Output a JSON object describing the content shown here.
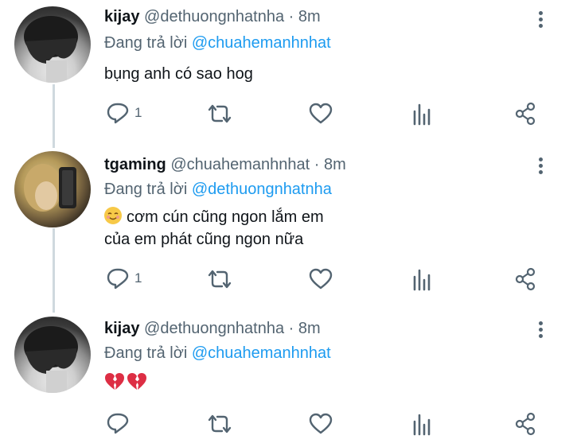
{
  "tweets": [
    {
      "name": "kijay",
      "handle": "@dethuongnhatnha",
      "time": "8m",
      "reply_prefix": "Đang trả lời",
      "reply_to": "@chuahemanhnhat",
      "lines": [
        "bụng anh có sao hog"
      ],
      "reply_count": "1",
      "avatar": "dark-hair-person"
    },
    {
      "name": "tgaming",
      "handle": "@chuahemanhnhat",
      "time": "8m",
      "reply_prefix": "Đang trả lời",
      "reply_to": "@dethuongnhatnha",
      "emoji": "smiling-face-emoji",
      "lines": [
        "cơm cún cũng ngon lắm em",
        "của em phát cũng ngon nữa"
      ],
      "reply_count": "1",
      "avatar": "blond-hair-person"
    },
    {
      "name": "kijay",
      "handle": "@dethuongnhatnha",
      "time": "8m",
      "reply_prefix": "Đang trả lời",
      "reply_to": "@chuahemanhnhat",
      "emoji": "broken-heart-emoji",
      "lines": [],
      "reply_count": "",
      "avatar": "dark-hair-person"
    }
  ],
  "separator": "·",
  "colors": {
    "mention": "#1d9bf0",
    "muted": "#536471",
    "text": "#0f1419",
    "thread": "#cfd9de"
  }
}
